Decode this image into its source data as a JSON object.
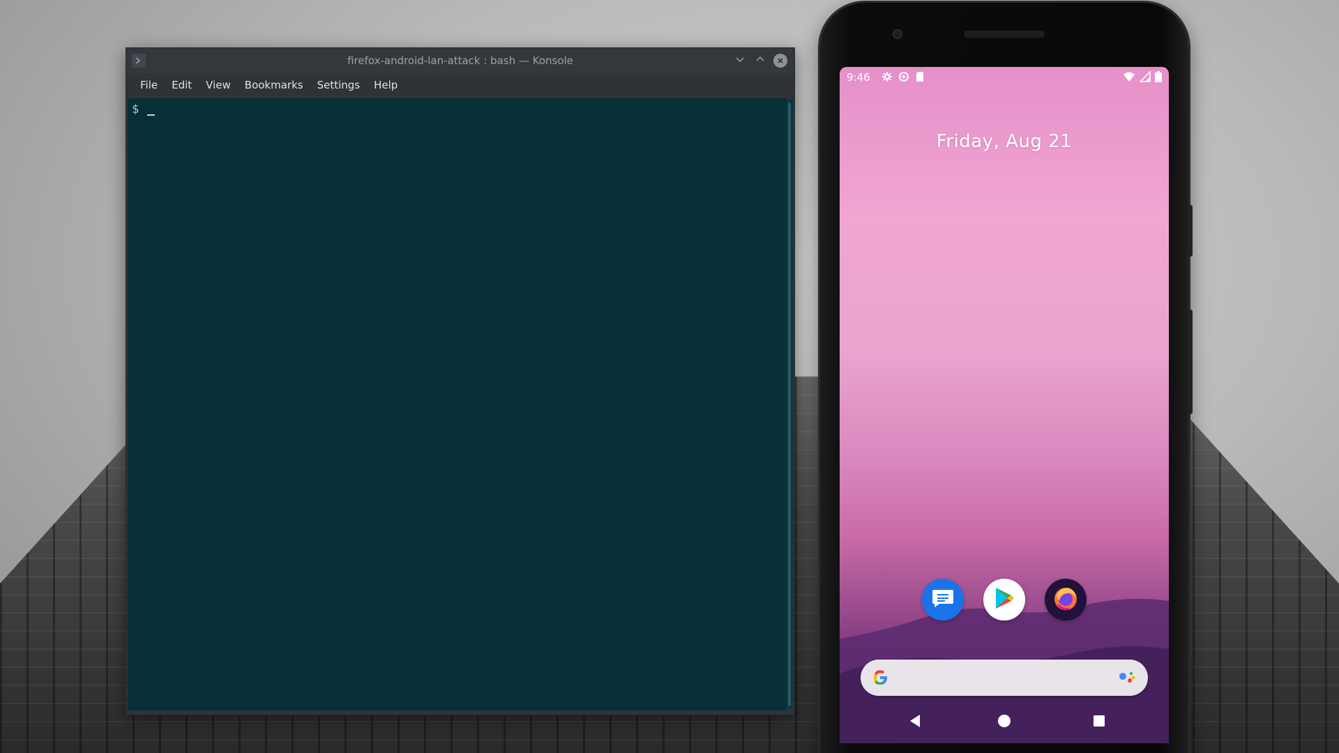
{
  "konsole": {
    "title": "firefox-android-lan-attack : bash — Konsole",
    "menu": [
      "File",
      "Edit",
      "View",
      "Bookmarks",
      "Settings",
      "Help"
    ],
    "prompt": "$",
    "background_color": "#062f38"
  },
  "phone": {
    "status_time": "9:46",
    "status_icons_left": [
      "settings-icon",
      "data-saver-icon",
      "sd-card-icon"
    ],
    "status_icons_right": [
      "wifi-icon",
      "signal-icon",
      "battery-icon"
    ],
    "date": "Friday, Aug 21",
    "dock_apps": [
      "messages-icon",
      "play-store-icon",
      "firefox-icon"
    ],
    "search_logo": "google-icon",
    "search_assistant": "assistant-icon",
    "nav": [
      "back-icon",
      "home-icon",
      "recents-icon"
    ]
  }
}
